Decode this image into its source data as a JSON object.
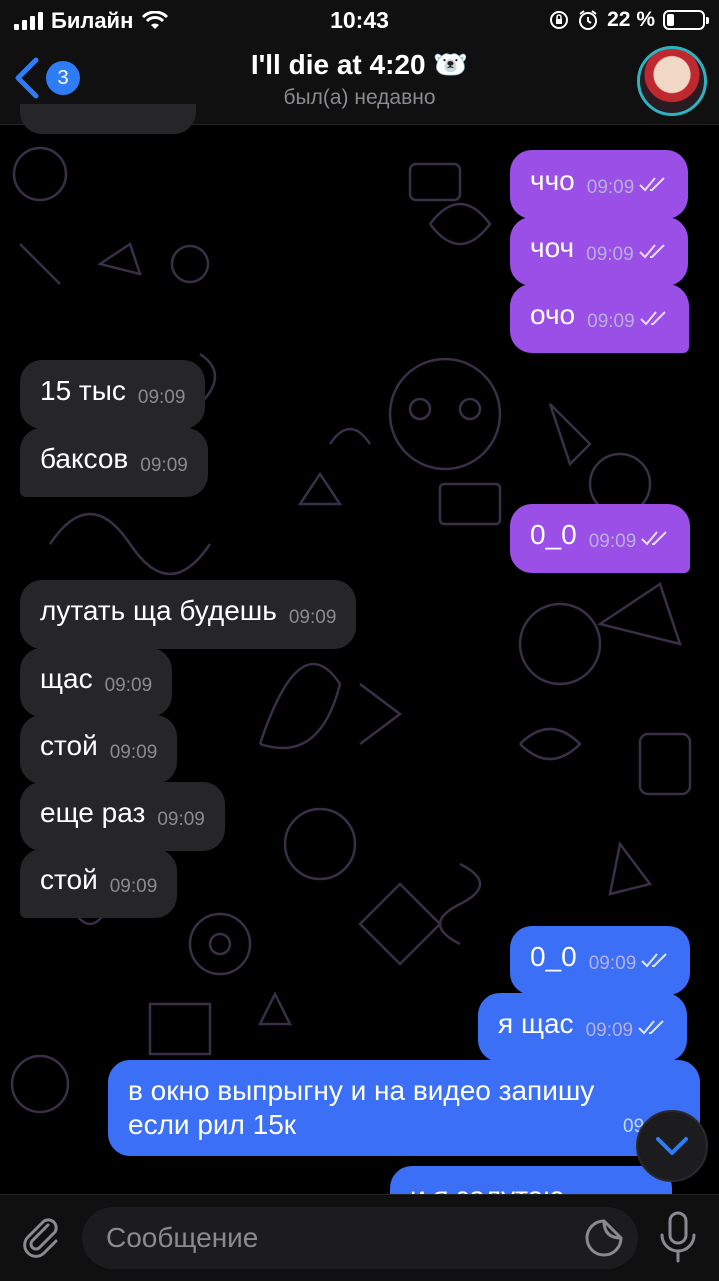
{
  "status_bar": {
    "carrier": "Билайн",
    "time": "10:43",
    "battery": "22 %",
    "battery_level": 0.22
  },
  "header": {
    "back_count": "3",
    "title": "I'll die at 4:20 🐻‍❄️",
    "subtitle": "был(а) недавно"
  },
  "messages": [
    {
      "text": "ччо",
      "time": "09:09"
    },
    {
      "text": "чоч",
      "time": "09:09"
    },
    {
      "text": "очо",
      "time": "09:09"
    },
    {
      "text": "15 тыс",
      "time": "09:09"
    },
    {
      "text": "баксов",
      "time": "09:09"
    },
    {
      "text": "0_0",
      "time": "09:09"
    },
    {
      "text": "лутать ща будешь",
      "time": "09:09"
    },
    {
      "text": "щас",
      "time": "09:09"
    },
    {
      "text": "стой",
      "time": "09:09"
    },
    {
      "text": "еще раз",
      "time": "09:09"
    },
    {
      "text": "стой",
      "time": "09:09"
    },
    {
      "text": "0_0",
      "time": "09:09"
    },
    {
      "text": "я щас",
      "time": "09:09"
    },
    {
      "text": "в окно выпрыгну и на видео запишу",
      "text2": "если рил 15к",
      "time": "09:1"
    },
    {
      "text": "и я залутаю"
    }
  ],
  "input": {
    "placeholder": "Сообщение"
  },
  "icons": {
    "back": "chevron-left-icon",
    "attach": "paperclip-icon",
    "sticker": "sticker-icon",
    "mic": "microphone-icon",
    "scroll": "chevron-down-icon",
    "read": "double-check-icon"
  },
  "colors": {
    "outgoing": "#9a4fe6",
    "outgoing_latest": "#3b6ff5",
    "incoming": "#262628",
    "accent": "#2e7cf6"
  }
}
